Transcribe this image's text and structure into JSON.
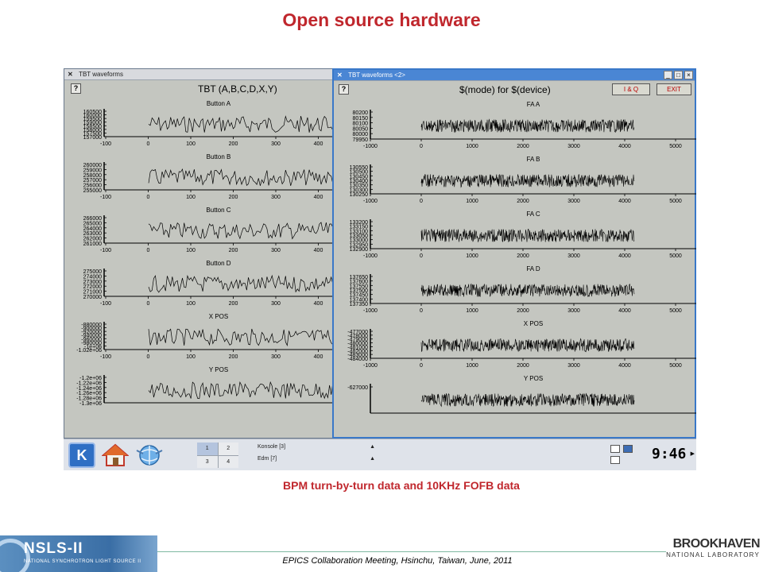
{
  "slide": {
    "title": "Open source hardware",
    "caption": "BPM turn-by-turn data and 10KHz FOFB data",
    "footer": "EPICS Collaboration Meeting, Hsinchu, Taiwan, June, 2011",
    "logo_left_main": "NSLS-II",
    "logo_left_sub": "NATIONAL SYNCHROTRON LIGHT SOURCE II",
    "logo_right_main": "BROOKHAVEN",
    "logo_right_sub": "NATIONAL LABORATORY"
  },
  "colors": {
    "title_red": "#c0272d",
    "window_bg": "#c4c6c0",
    "active_border": "#3a78c8"
  },
  "left_window": {
    "titlebar": "TBT waveforms",
    "help_label": "?",
    "title": "TBT (A,B,C,D,X,Y)",
    "plots": [
      {
        "name": "Button A",
        "yticks": [
          "160500",
          "160000",
          "159500",
          "159000",
          "158500",
          "158000",
          "157500",
          "157000"
        ],
        "xticks": [
          "-100",
          "0",
          "100",
          "200",
          "300",
          "400"
        ]
      },
      {
        "name": "Button B",
        "yticks": [
          "260000",
          "259000",
          "258000",
          "257000",
          "256000",
          "255000"
        ],
        "xticks": [
          "-100",
          "0",
          "100",
          "200",
          "300",
          "400"
        ]
      },
      {
        "name": "Button C",
        "yticks": [
          "266000",
          "265000",
          "264000",
          "263000",
          "262000",
          "261000"
        ],
        "xticks": [
          "-100",
          "0",
          "100",
          "200",
          "300",
          "400"
        ]
      },
      {
        "name": "Button D",
        "yticks": [
          "275000",
          "274000",
          "273000",
          "272000",
          "271000",
          "270000"
        ],
        "xticks": [
          "-100",
          "0",
          "100",
          "200",
          "300",
          "400"
        ]
      },
      {
        "name": "X POS",
        "yticks": [
          "-880000",
          "-900000",
          "-920000",
          "-940000",
          "-960000",
          "-980000",
          "-1e+06",
          "-1.02e+06"
        ],
        "xticks": [
          "-100",
          "0",
          "100",
          "200",
          "300",
          "400"
        ]
      },
      {
        "name": "Y POS",
        "yticks": [
          "-1.2e+06",
          "-1.22e+06",
          "-1.24e+06",
          "-1.26e+06",
          "-1.28e+06",
          "-1.3e+06"
        ],
        "xticks": []
      }
    ]
  },
  "right_window": {
    "titlebar": "TBT waveforms <2>",
    "help_label": "?",
    "title": "$(mode) for $(device)",
    "iq_label": "I & Q",
    "exit_label": "EXIT",
    "plots": [
      {
        "name": "FA A",
        "yticks": [
          "80200",
          "80150",
          "80100",
          "80050",
          "80000",
          "79950"
        ],
        "xticks": [
          "-1000",
          "0",
          "1000",
          "2000",
          "3000",
          "4000",
          "5000"
        ]
      },
      {
        "name": "FA B",
        "yticks": [
          "130550",
          "130500",
          "130450",
          "130400",
          "130350",
          "130300",
          "130250"
        ],
        "xticks": [
          "-1000",
          "0",
          "1000",
          "2000",
          "3000",
          "4000",
          "5000"
        ]
      },
      {
        "name": "FA C",
        "yticks": [
          "133200",
          "133150",
          "133100",
          "133050",
          "133000",
          "132950",
          "132900"
        ],
        "xticks": [
          "-1000",
          "0",
          "1000",
          "2000",
          "3000",
          "4000",
          "5000"
        ]
      },
      {
        "name": "FA D",
        "yticks": [
          "137650",
          "137600",
          "137550",
          "137500",
          "137450",
          "137400",
          "137350"
        ],
        "xticks": [
          "-1000",
          "0",
          "1000",
          "2000",
          "3000",
          "4000",
          "5000"
        ]
      },
      {
        "name": "X POS",
        "yticks": [
          "-477000",
          "-478000",
          "-479000",
          "-480000",
          "-481000",
          "-482000",
          "-483000",
          "-484000"
        ],
        "xticks": [
          "-1000",
          "0",
          "1000",
          "2000",
          "3000",
          "4000",
          "5000"
        ]
      },
      {
        "name": "Y POS",
        "yticks": [
          "-627000"
        ],
        "xticks": []
      }
    ]
  },
  "taskbar": {
    "pager": [
      "1",
      "2",
      "3",
      "4"
    ],
    "tasks": [
      "Konsole [3]",
      "Edm [7]"
    ],
    "clock": "9:46"
  }
}
